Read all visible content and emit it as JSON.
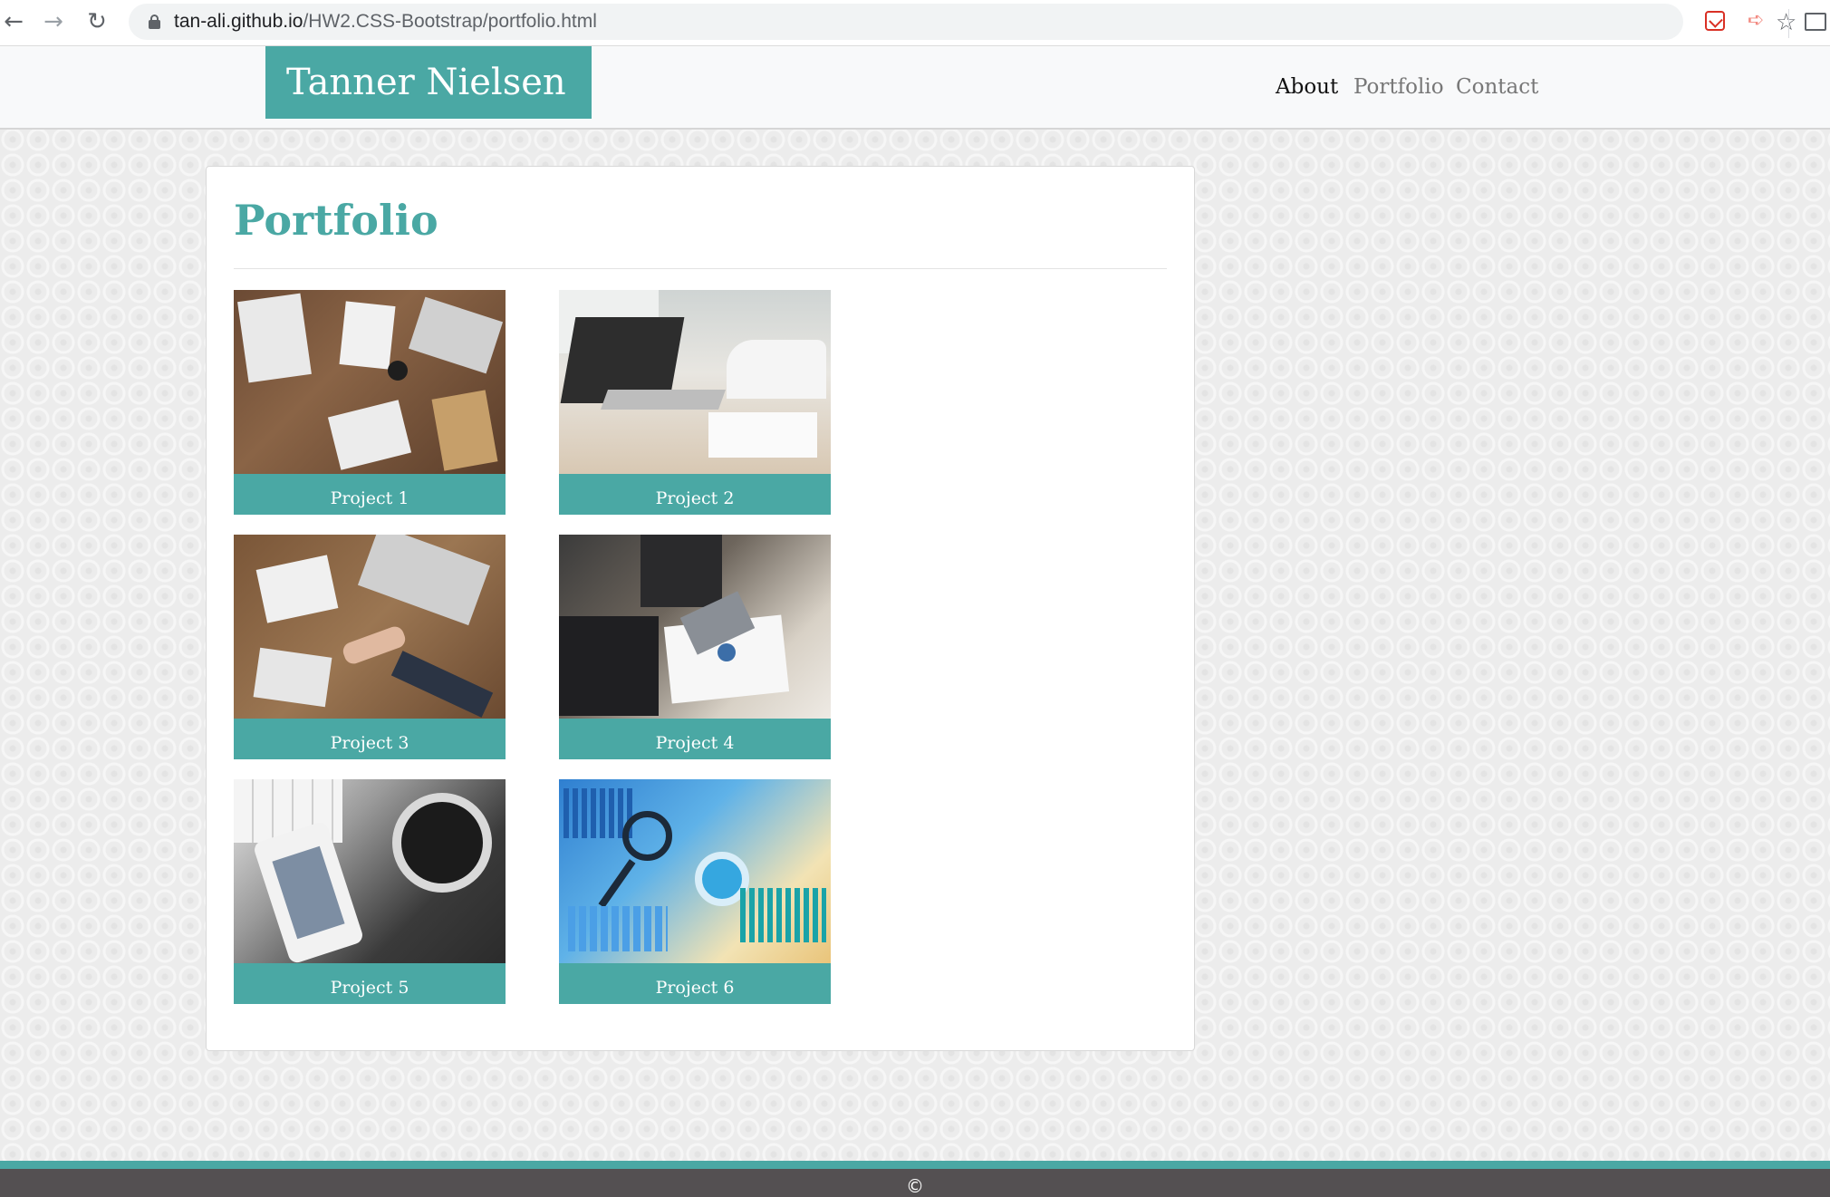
{
  "browser": {
    "url_host": "tan-ali.github.io",
    "url_path": "/HW2.CSS-Bootstrap/portfolio.html"
  },
  "header": {
    "brand": "Tanner Nielsen",
    "nav": [
      {
        "label": "About",
        "active": true
      },
      {
        "label": "Portfolio",
        "active": false
      },
      {
        "label": "Contact",
        "active": false
      }
    ]
  },
  "main": {
    "title": "Portfolio",
    "projects": [
      {
        "label": "Project 1"
      },
      {
        "label": "Project 2"
      },
      {
        "label": "Project 3"
      },
      {
        "label": "Project 4"
      },
      {
        "label": "Project 5"
      },
      {
        "label": "Project 6"
      }
    ]
  },
  "footer": {
    "text": "©"
  },
  "colors": {
    "accent": "#4aa8a4",
    "footer_bg": "#545052"
  }
}
